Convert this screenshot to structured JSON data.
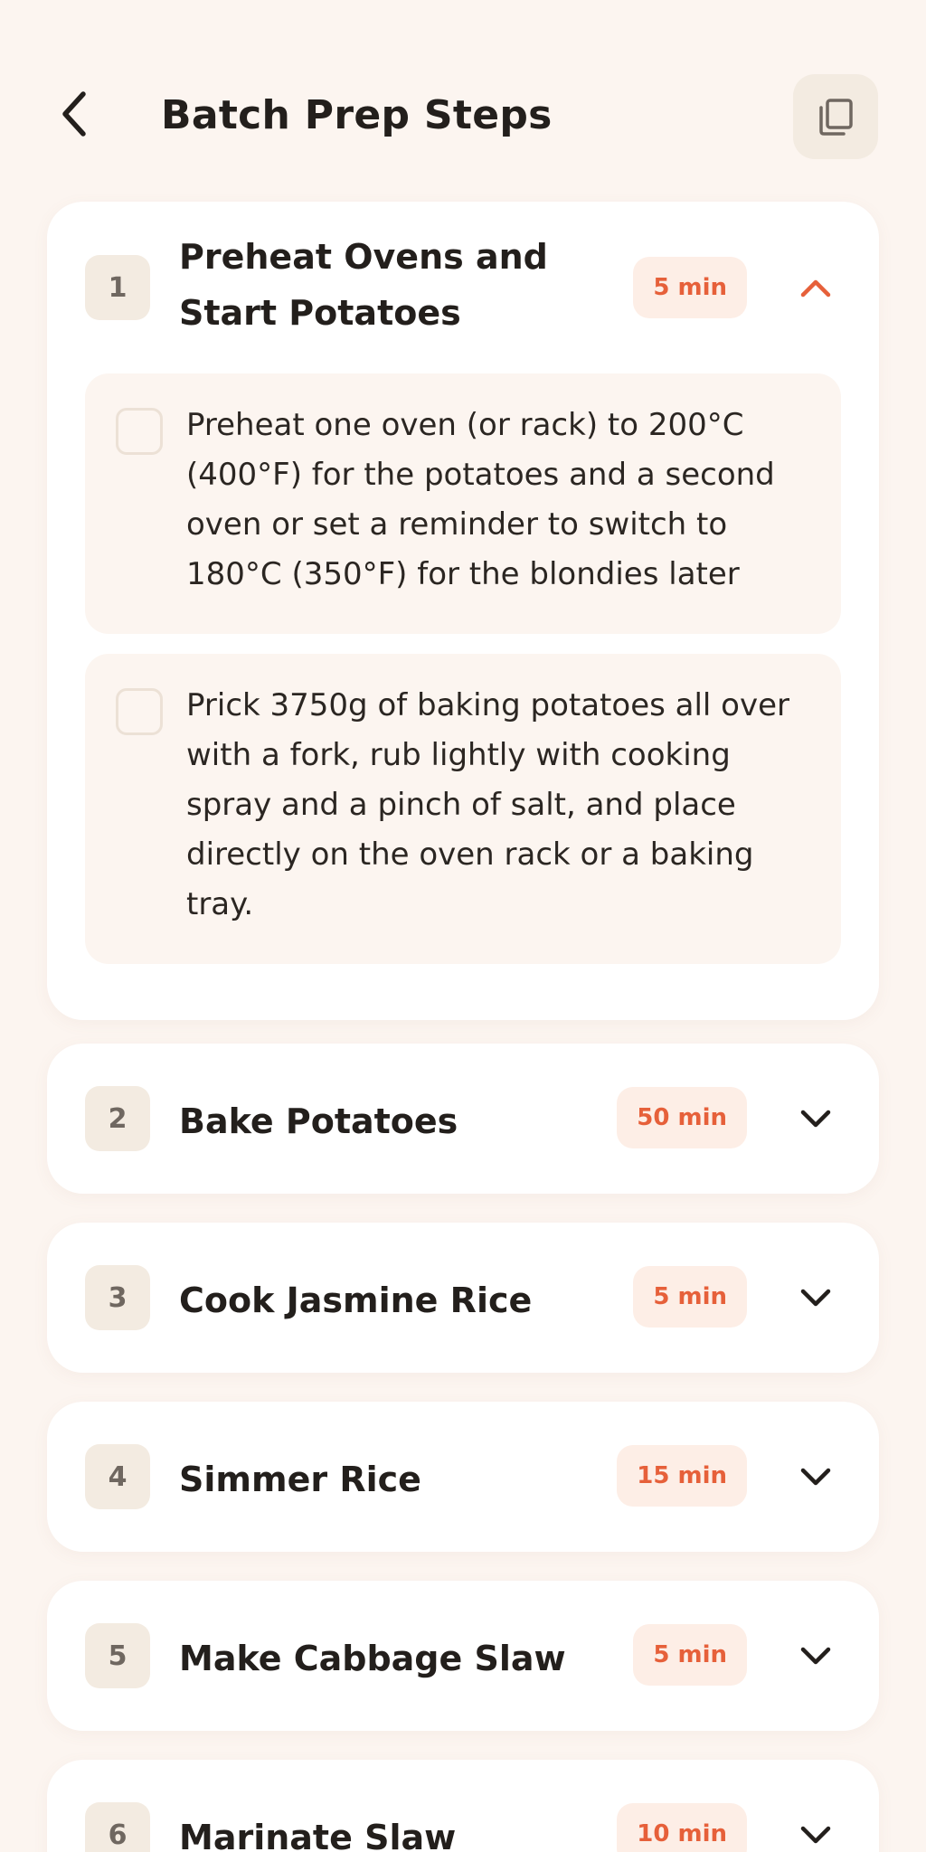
{
  "header": {
    "title": "Batch Prep Steps",
    "back_icon": "chevron-left-icon",
    "copy_icon": "copy-icon"
  },
  "colors": {
    "background": "#fcf5f0",
    "card": "#ffffff",
    "accent": "#e6603a",
    "badge_bg": "#fdeee6",
    "number_bg": "#f3ebe1"
  },
  "steps": [
    {
      "number": "1",
      "title": "Preheat Ovens and Start Potatoes",
      "duration": "5 min",
      "expanded": true,
      "tasks": [
        {
          "text": "Preheat one oven (or rack) to 200°C (400°F) for the potatoes and a second oven or set a reminder to switch to 180°C (350°F) for the blondies later",
          "checked": false
        },
        {
          "text": "Prick 3750g of baking potatoes all over with a fork, rub lightly with cooking spray and a pinch of salt, and place directly on the oven rack or a baking tray.",
          "checked": false
        }
      ]
    },
    {
      "number": "2",
      "title": "Bake Potatoes",
      "duration": "50 min",
      "expanded": false
    },
    {
      "number": "3",
      "title": "Cook Jasmine Rice",
      "duration": "5 min",
      "expanded": false
    },
    {
      "number": "4",
      "title": "Simmer Rice",
      "duration": "15 min",
      "expanded": false
    },
    {
      "number": "5",
      "title": "Make Cabbage Slaw",
      "duration": "5 min",
      "expanded": false
    },
    {
      "number": "6",
      "title": "Marinate Slaw",
      "duration": "10 min",
      "expanded": false
    }
  ]
}
